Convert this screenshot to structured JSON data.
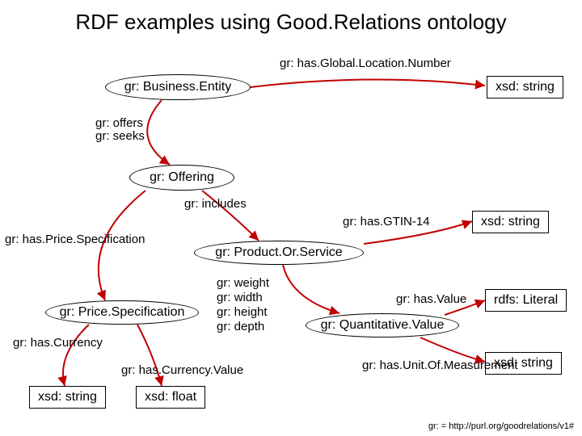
{
  "title": "RDF examples using Good.Relations ontology",
  "nodes": {
    "businessEntity": "gr: Business.Entity",
    "offering": "gr: Offering",
    "productOrService": "gr: Product.Or.Service",
    "priceSpecification": "gr: Price.Specification",
    "quantitativeValue": "gr: Quantitative.Value"
  },
  "datatypes": {
    "xsdString1": "xsd: string",
    "xsdString2": "xsd: string",
    "xsdString3": "xsd: string",
    "xsdString4": "xsd: string",
    "xsdFloat": "xsd: float",
    "rdfsLiteral": "rdfs: Literal"
  },
  "edges": {
    "hasGlobalLocationNumber": "gr: has.Global.Location.Number",
    "offers": "gr: offers",
    "seeks": "gr: seeks",
    "includes": "gr: includes",
    "hasGTIN14": "gr: has.GTIN-14",
    "hasPriceSpecification": "gr: has.Price.Specification",
    "weight": "gr: weight",
    "width": "gr: width",
    "height": "gr: height",
    "depth": "gr: depth",
    "hasCurrency": "gr: has.Currency",
    "hasCurrencyValue": "gr: has.Currency.Value",
    "hasValue": "gr: has.Value",
    "hasUnitOfMeasurement": "gr: has.Unit.Of.Measurement"
  },
  "footnote": "gr: = http://purl.org/goodrelations/v1#"
}
